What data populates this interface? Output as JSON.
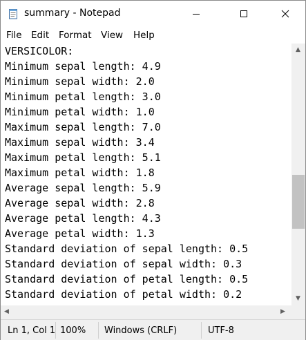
{
  "window": {
    "title": "summary - Notepad",
    "icon": "notepad-icon"
  },
  "menu": {
    "items": [
      "File",
      "Edit",
      "Format",
      "View",
      "Help"
    ]
  },
  "document": {
    "lines": [
      "VERSICOLOR:",
      "Minimum sepal length: 4.9",
      "Minimum sepal width: 2.0",
      "Minimum petal length: 3.0",
      "Minimum petal width: 1.0",
      "Maximum sepal length: 7.0",
      "Maximum sepal width: 3.4",
      "Maximum petal length: 5.1",
      "Maximum petal width: 1.8",
      "Average sepal length: 5.9",
      "Average sepal width: 2.8",
      "Average petal length: 4.3",
      "Average petal width: 1.3",
      "Standard deviation of sepal length: 0.5",
      "Standard deviation of sepal width: 0.3",
      "Standard deviation of petal length: 0.5",
      "Standard deviation of petal width: 0.2"
    ]
  },
  "status": {
    "position": "Ln 1, Col 1",
    "zoom": "100%",
    "line_ending": "Windows (CRLF)",
    "encoding": "UTF-8"
  }
}
